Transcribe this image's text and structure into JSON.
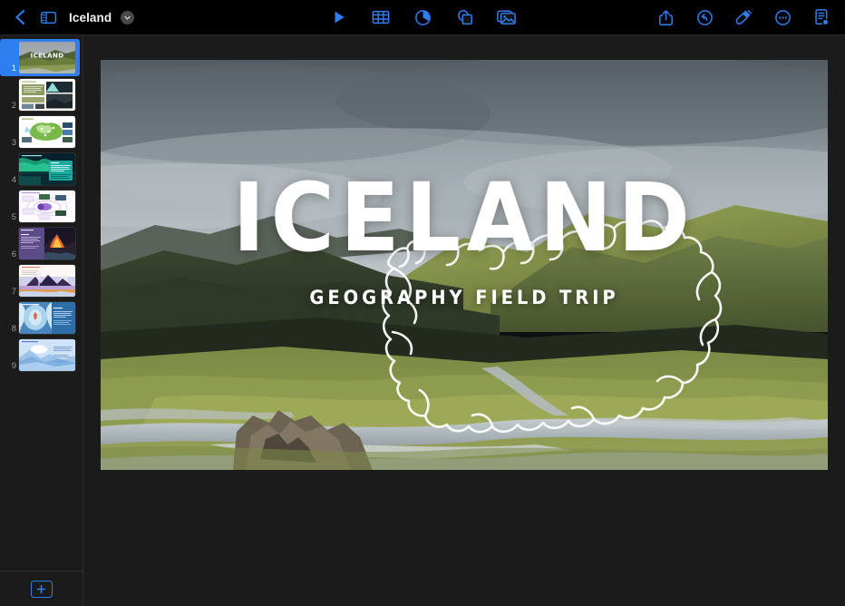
{
  "window": {
    "title": "Iceland"
  },
  "toolbar": {
    "back_label": "Back",
    "navigator_toggle": "sidebar-toggle",
    "title": "Iceland",
    "title_menu_chevron": "chevron-down-icon",
    "center_items": [
      {
        "name": "play-button",
        "label": "Play"
      },
      {
        "name": "insert-table-button",
        "label": "Table"
      },
      {
        "name": "insert-chart-button",
        "label": "Chart"
      },
      {
        "name": "insert-shape-button",
        "label": "Shape"
      },
      {
        "name": "insert-media-button",
        "label": "Media"
      }
    ],
    "right_items": [
      {
        "name": "share-button",
        "label": "Share"
      },
      {
        "name": "undo-button",
        "label": "Undo"
      },
      {
        "name": "format-button",
        "label": "Format"
      },
      {
        "name": "more-button",
        "label": "More"
      },
      {
        "name": "document-options-button",
        "label": "Document"
      }
    ]
  },
  "sidebar": {
    "add_slide_label": "+",
    "selected_index": 1,
    "slides": [
      {
        "number": "1",
        "name": "slide-thumbnail-1",
        "title": "ICELAND",
        "kind": "title-photo"
      },
      {
        "number": "2",
        "name": "slide-thumbnail-2",
        "kind": "text-and-photos"
      },
      {
        "number": "3",
        "name": "slide-thumbnail-3",
        "kind": "map"
      },
      {
        "number": "4",
        "name": "slide-thumbnail-4",
        "kind": "aurora-photo"
      },
      {
        "number": "5",
        "name": "slide-thumbnail-5",
        "kind": "diagram"
      },
      {
        "number": "6",
        "name": "slide-thumbnail-6",
        "kind": "volcano-photo"
      },
      {
        "number": "7",
        "name": "slide-thumbnail-7",
        "kind": "geyser-illustration"
      },
      {
        "number": "8",
        "name": "slide-thumbnail-8",
        "kind": "ice-cave-photo"
      },
      {
        "number": "9",
        "name": "slide-thumbnail-9",
        "kind": "glacier-illustration"
      }
    ]
  },
  "slide": {
    "title": "ICELAND",
    "subtitle": "GEOGRAPHY FIELD TRIP",
    "background": "iceland-landscape-photo",
    "overlay_shape": "iceland-map-outline"
  },
  "colors": {
    "accent": "#2f7ef0",
    "toolbar_bg": "#000000",
    "canvas_bg": "#1b1b1b",
    "sidebar_bg": "#1b1b1b",
    "text": "#ffffff"
  }
}
